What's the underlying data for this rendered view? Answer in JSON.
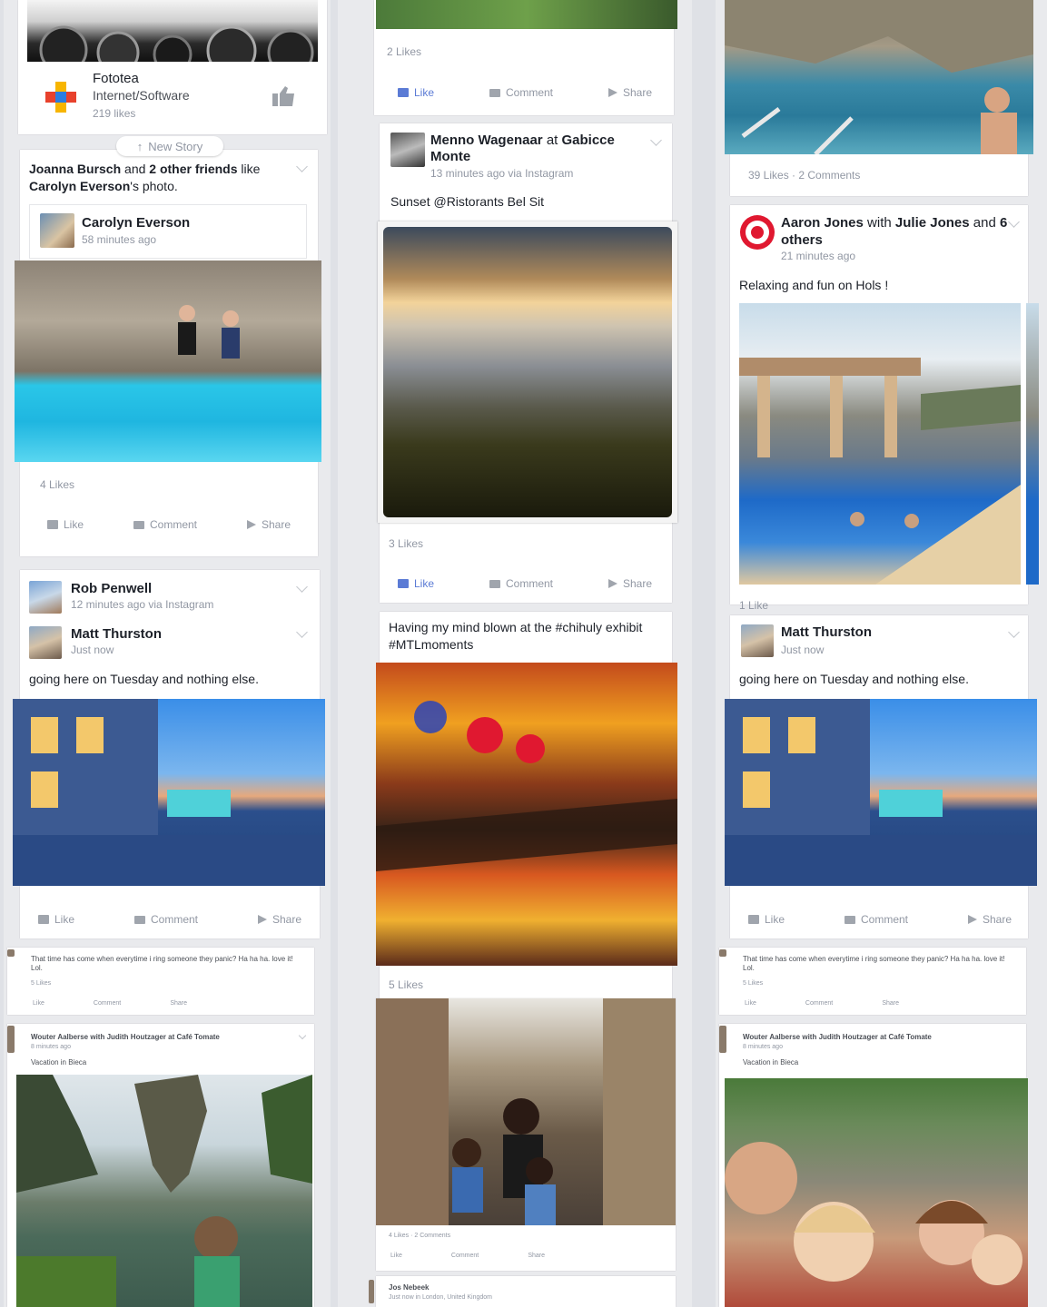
{
  "col1": {
    "page_card": {
      "name": "Fototea",
      "category": "Internet/Software",
      "likes": "219 likes"
    },
    "new_story": "New Story",
    "story1": {
      "header_a": "Joanna Bursch",
      "header_and": "and",
      "header_b": "2 other friends",
      "header_like": "like",
      "header_c": "Carolyn Everson",
      "header_d": "'s photo.",
      "author": "Carolyn Everson",
      "time": "58 minutes ago",
      "likes": "4 Likes"
    },
    "story2": {
      "author": "Rob Penwell",
      "time": "12 minutes ago via Instagram"
    },
    "story3": {
      "author": "Matt Thurston",
      "time": "Just now",
      "text": "going here on Tuesday and nothing else."
    },
    "mini1": {
      "text": "That time has come when everytime i ring someone they panic? Ha ha ha. love it! Lol.",
      "likes": "5 Likes"
    },
    "mini2": {
      "author": "Wouter Aalberse with Judith Houtzager at Café Tomate",
      "time": "8 minutes ago",
      "text": "Vacation in Bieca"
    }
  },
  "col2": {
    "top_likes": "2 Likes",
    "story1": {
      "author": "Menno Wagenaar",
      "at": "at",
      "place": "Gabicce Monte",
      "time": "13 minutes ago via Instagram",
      "text": "Sunset @Ristorants Bel Sit",
      "likes": "3 Likes"
    },
    "story2": {
      "text": "Having my mind blown at the #chihuly exhibit #MTLmoments",
      "likes": "5 Likes"
    },
    "story3": {
      "likes": "4 Likes · 2 Comments"
    },
    "story4": {
      "author": "Jos Nebeek",
      "time": "Just now in London, United Kingdom"
    }
  },
  "col3": {
    "top_likes": "39 Likes · 2 Comments",
    "story1": {
      "author": "Aaron Jones",
      "with": "with",
      "tagged": "Julie Jones",
      "and": "and",
      "others": "6 others",
      "time": "21 minutes ago",
      "text": "Relaxing and fun on Hols !",
      "likes": "1 Like"
    },
    "story2": {
      "author": "Matt Thurston",
      "time": "Just now",
      "text": "going here on Tuesday and nothing else."
    },
    "mini1": {
      "text": "That time has come when everytime i ring someone they panic? Ha ha ha. love it! Lol.",
      "likes": "5 Likes"
    },
    "mini2": {
      "author": "Wouter Aalberse with Judith Houtzager at Café Tomate",
      "time": "8 minutes ago",
      "text": "Vacation in Bieca"
    }
  },
  "actions": {
    "like": "Like",
    "comment": "Comment",
    "share": "Share"
  }
}
